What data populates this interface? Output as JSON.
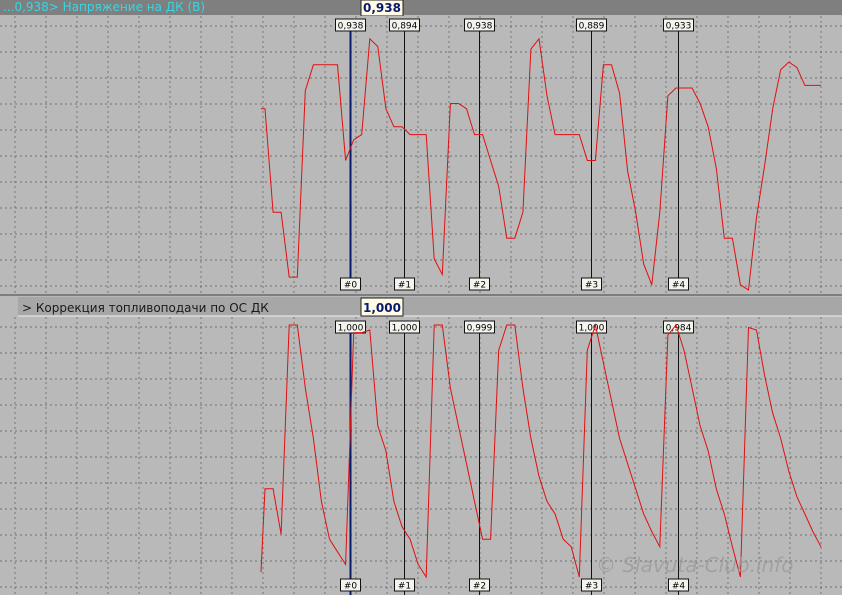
{
  "panels": [
    {
      "title": "...0,938>  Напряжение на ДК (В)",
      "readout": "0,938"
    },
    {
      "title": ">  Коррекция топливоподачи по ОС ДК",
      "readout": "1,000"
    }
  ],
  "watermark": "© Slavuta-Club.info",
  "colors": {
    "background": "#b9b9b9",
    "signal": "#e01010",
    "top_header": "#7f7f7f",
    "bottom_header": "#a7a7a7",
    "title_text_top": "#35d7e6",
    "readout_bg": "#fffbe6"
  },
  "chart_data": [
    {
      "type": "line",
      "title": "Напряжение на ДК (В)",
      "grid": true,
      "ylim": [
        0,
        1
      ],
      "x": [
        0,
        0.2,
        0.6,
        1.0,
        1.4,
        1.8,
        2.2,
        2.6,
        3.0,
        3.4,
        3.8,
        4.2,
        4.6,
        5.0,
        5.4,
        5.8,
        6.2,
        6.6,
        7.0,
        7.4,
        7.8,
        8.2,
        8.6,
        9.0,
        9.4,
        9.8,
        10.2,
        10.6,
        11.0,
        11.4,
        11.8,
        12.2,
        12.6,
        13.0,
        13.4,
        13.8,
        14.2,
        14.6,
        15.0,
        15.4,
        15.8,
        16.2,
        16.6,
        17.0,
        17.4,
        17.8,
        18.2,
        18.6,
        19.0,
        19.4,
        19.8,
        20.2,
        20.6,
        21.0,
        21.4,
        21.8,
        22.2,
        22.6,
        23.0,
        23.4,
        23.8,
        24.2,
        24.6,
        25.0,
        25.4,
        25.8,
        26.2,
        26.6,
        27.0,
        27.4,
        27.8
      ],
      "series": [
        {
          "values": [
            0.7,
            0.7,
            0.3,
            0.3,
            0.05,
            0.05,
            0.77,
            0.87,
            0.87,
            0.87,
            0.87,
            0.5,
            0.58,
            0.6,
            0.97,
            0.94,
            0.7,
            0.63,
            0.63,
            0.6,
            0.6,
            0.6,
            0.12,
            0.06,
            0.72,
            0.72,
            0.7,
            0.6,
            0.6,
            0.5,
            0.4,
            0.2,
            0.2,
            0.3,
            0.93,
            0.97,
            0.75,
            0.6,
            0.6,
            0.6,
            0.6,
            0.5,
            0.5,
            0.87,
            0.87,
            0.76,
            0.46,
            0.3,
            0.1,
            0.02,
            0.3,
            0.75,
            0.78,
            0.78,
            0.78,
            0.72,
            0.63,
            0.47,
            0.2,
            0.2,
            0.02,
            0.0,
            0.28,
            0.48,
            0.7,
            0.85,
            0.88,
            0.86,
            0.79,
            0.79,
            0.79
          ]
        }
      ],
      "markers": [
        {
          "label": "#0",
          "value": "0,938",
          "x": 4.4
        },
        {
          "label": "#1",
          "value": "0,894",
          "x": 7.1
        },
        {
          "label": "#2",
          "value": "0,938",
          "x": 10.8
        },
        {
          "label": "#3",
          "value": "0,889",
          "x": 16.4
        },
        {
          "label": "#4",
          "value": "0,933",
          "x": 20.7
        }
      ]
    },
    {
      "type": "line",
      "title": "Коррекция топливоподачи по ОС ДК",
      "grid": true,
      "ylim": [
        0,
        1
      ],
      "x": [
        0,
        0.2,
        0.6,
        1.0,
        1.4,
        1.8,
        2.2,
        2.6,
        3.0,
        3.4,
        3.8,
        4.2,
        4.6,
        5.0,
        5.4,
        5.8,
        6.2,
        6.6,
        7.0,
        7.4,
        7.8,
        8.2,
        8.6,
        9.0,
        9.4,
        9.8,
        10.2,
        10.6,
        11.0,
        11.4,
        11.8,
        12.2,
        12.6,
        13.0,
        13.4,
        13.8,
        14.2,
        14.6,
        15.0,
        15.4,
        15.8,
        16.2,
        16.6,
        17.0,
        17.4,
        17.8,
        18.2,
        18.6,
        19.0,
        19.4,
        19.8,
        20.2,
        20.6,
        21.0,
        21.4,
        21.8,
        22.2,
        22.6,
        23.0,
        23.4,
        23.8,
        24.2,
        24.6,
        25.0,
        25.4,
        25.8,
        26.2,
        26.6,
        27.0,
        27.4,
        27.8
      ],
      "series": [
        {
          "values": [
            0.02,
            0.35,
            0.35,
            0.17,
            1.0,
            1.0,
            0.75,
            0.55,
            0.3,
            0.15,
            0.1,
            0.05,
            0.97,
            0.97,
            0.98,
            0.6,
            0.5,
            0.3,
            0.2,
            0.15,
            0.05,
            0.0,
            1.0,
            1.0,
            0.75,
            0.6,
            0.45,
            0.3,
            0.15,
            0.15,
            0.9,
            1.0,
            1.0,
            0.75,
            0.55,
            0.4,
            0.3,
            0.25,
            0.15,
            0.12,
            0.0,
            0.9,
            1.0,
            0.85,
            0.7,
            0.55,
            0.45,
            0.35,
            0.25,
            0.18,
            0.12,
            0.96,
            1.0,
            0.9,
            0.75,
            0.6,
            0.5,
            0.35,
            0.25,
            0.12,
            0.0,
            0.99,
            0.98,
            0.8,
            0.65,
            0.55,
            0.42,
            0.32,
            0.25,
            0.18,
            0.12
          ]
        }
      ],
      "markers": [
        {
          "label": "#0",
          "value": "1,000",
          "x": 4.4
        },
        {
          "label": "#1",
          "value": "1,000",
          "x": 7.1
        },
        {
          "label": "#2",
          "value": "0,999",
          "x": 10.8
        },
        {
          "label": "#3",
          "value": "1,000",
          "x": 16.4
        },
        {
          "label": "#4",
          "value": "0,984",
          "x": 20.7
        }
      ]
    }
  ]
}
